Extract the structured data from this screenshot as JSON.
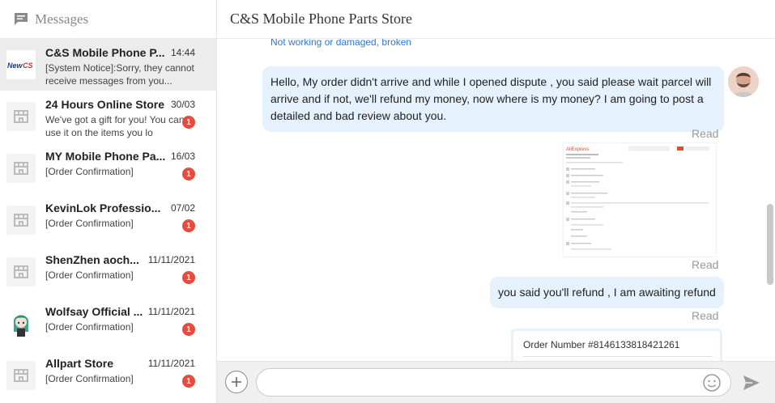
{
  "sidebar": {
    "title": "Messages",
    "conversations": [
      {
        "name": "C&S Mobile Phone P...",
        "time": "14:44",
        "preview": "[System Notice]:Sorry, they cannot receive messages from you...",
        "badge": "",
        "logo_text": "NewCS"
      },
      {
        "name": "24 Hours Online Store",
        "time": "30/03",
        "preview": "We've got a gift for you! You can use it on the items you lo",
        "badge": "1"
      },
      {
        "name": "MY Mobile Phone Pa...",
        "time": "16/03",
        "preview": "[Order Confirmation]",
        "badge": "1"
      },
      {
        "name": "KevinLok Professio...",
        "time": "07/02",
        "preview": "[Order Confirmation]",
        "badge": "1"
      },
      {
        "name": "ShenZhen aoch...",
        "time": "11/11/2021",
        "preview": "[Order Confirmation]",
        "badge": "1"
      },
      {
        "name": "Wolfsay Official ...",
        "time": "11/11/2021",
        "preview": "[Order Confirmation]",
        "badge": "1"
      },
      {
        "name": "Allpart Store",
        "time": "11/11/2021",
        "preview": "[Order Confirmation]",
        "badge": "1"
      }
    ]
  },
  "chat": {
    "title": "C&S Mobile Phone Parts Store",
    "link_text": "Not working or damaged, broken",
    "messages": [
      {
        "text": "Hello, My order didn't arrive and while I opened dispute , you said please wait parcel will arrive and if not, we'll refund my money, now where is my money? I am going to post a detailed and bad review about you.",
        "status": "Read"
      },
      {
        "image_label": "AliExpress",
        "status": "Read"
      },
      {
        "text": "you said you'll refund , I am awaiting refund",
        "status": "Read"
      }
    ],
    "order_card": {
      "order_number": "Order Number #8146133818421261"
    }
  },
  "input": {
    "placeholder": "",
    "value": ""
  },
  "colors": {
    "bubble": "#e5f1fd",
    "badge": "#e64c3c",
    "link": "#2b7bd1",
    "active_row": "#ececec"
  }
}
